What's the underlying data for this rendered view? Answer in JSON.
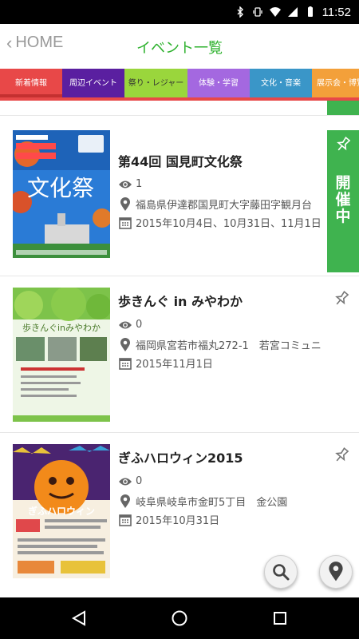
{
  "status_bar": {
    "time": "11:52"
  },
  "header": {
    "back_label": "HOME",
    "title": "イベント一覧"
  },
  "tabs": [
    {
      "label": "新着情報",
      "color": "#e84848"
    },
    {
      "label": "周辺イベント",
      "color": "#5a1fa0"
    },
    {
      "label": "祭り・レジャー",
      "color": "#9ad63c"
    },
    {
      "label": "体験・学習",
      "color": "#a468e0"
    },
    {
      "label": "文化・音楽",
      "color": "#3a96c8"
    },
    {
      "label": "展示会・博覧",
      "color": "#f3a03a"
    }
  ],
  "events": [
    {
      "title": "第44回 国見町文化祭",
      "views": "1",
      "location": "福島県伊達郡国見町大字藤田字観月台",
      "dates": "2015年10月4日、10月31日、11月1日",
      "badge": "開催中",
      "poster_text": "文化祭"
    },
    {
      "title": "歩きんぐ in みやわか",
      "views": "0",
      "location": "福岡県宮若市福丸272-1　若宮コミュニ",
      "dates": "2015年11月1日",
      "poster_text": "歩きんぐinみやわか"
    },
    {
      "title": "ぎふハロウィン2015",
      "views": "0",
      "location": "岐阜県岐阜市金町5丁目　金公園",
      "dates": "2015年10月31日",
      "poster_text": "ぎふハロウィン"
    }
  ],
  "colors": {
    "accent_green": "#2db12d",
    "badge_green": "#3fb34f"
  }
}
